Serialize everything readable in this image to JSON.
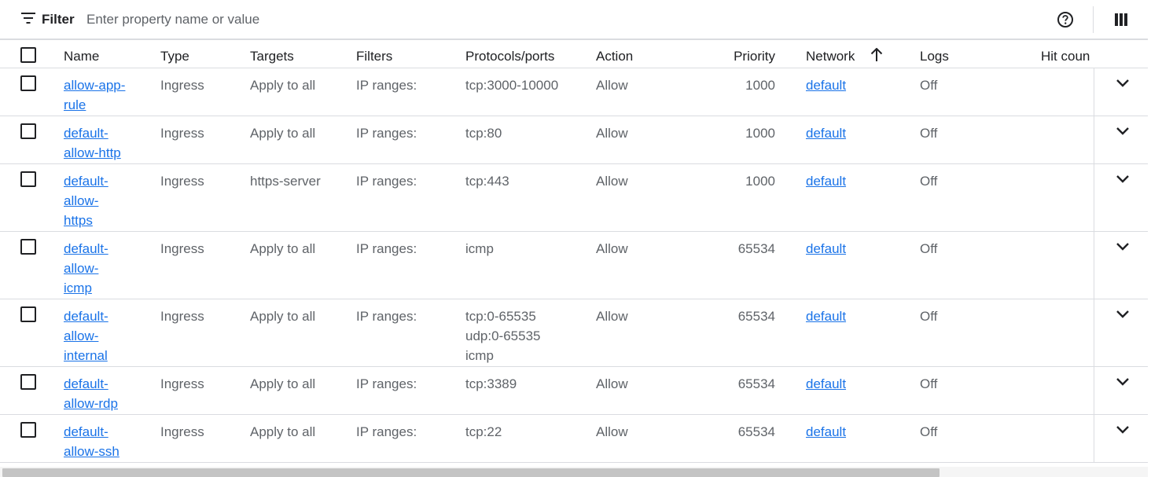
{
  "toolbar": {
    "filter_label": "Filter",
    "filter_placeholder": "Enter property name or value"
  },
  "columns": {
    "name": "Name",
    "type": "Type",
    "targets": "Targets",
    "filters": "Filters",
    "protocols": "Protocols/ports",
    "action": "Action",
    "priority": "Priority",
    "network": "Network",
    "logs": "Logs",
    "hit_count": "Hit coun"
  },
  "rows": [
    {
      "name": "allow-app-rule",
      "type": "Ingress",
      "targets": "Apply to all",
      "filters": "IP ranges:",
      "protocols": "tcp:3000-10000",
      "action": "Allow",
      "priority": "1000",
      "network": "default",
      "logs": "Off"
    },
    {
      "name": "default-allow-http",
      "type": "Ingress",
      "targets": "Apply to all",
      "filters": "IP ranges:",
      "protocols": "tcp:80",
      "action": "Allow",
      "priority": "1000",
      "network": "default",
      "logs": "Off"
    },
    {
      "name": "default-allow-https",
      "type": "Ingress",
      "targets": "https-server",
      "filters": "IP ranges:",
      "protocols": "tcp:443",
      "action": "Allow",
      "priority": "1000",
      "network": "default",
      "logs": "Off"
    },
    {
      "name": "default-allow-icmp",
      "type": "Ingress",
      "targets": "Apply to all",
      "filters": "IP ranges:",
      "protocols": "icmp",
      "action": "Allow",
      "priority": "65534",
      "network": "default",
      "logs": "Off"
    },
    {
      "name": "default-allow-internal",
      "type": "Ingress",
      "targets": "Apply to all",
      "filters": "IP ranges:",
      "protocols": "tcp:0-65535\nudp:0-65535\nicmp",
      "action": "Allow",
      "priority": "65534",
      "network": "default",
      "logs": "Off"
    },
    {
      "name": "default-allow-rdp",
      "type": "Ingress",
      "targets": "Apply to all",
      "filters": "IP ranges:",
      "protocols": "tcp:3389",
      "action": "Allow",
      "priority": "65534",
      "network": "default",
      "logs": "Off"
    },
    {
      "name": "default-allow-ssh",
      "type": "Ingress",
      "targets": "Apply to all",
      "filters": "IP ranges:",
      "protocols": "tcp:22",
      "action": "Allow",
      "priority": "65534",
      "network": "default",
      "logs": "Off"
    }
  ],
  "icons": {
    "filter": "filter-lines-icon",
    "help": "help-circle-icon",
    "columns": "column-display-icon",
    "sort": "arrow-up-icon",
    "expand": "chevron-down-icon"
  }
}
